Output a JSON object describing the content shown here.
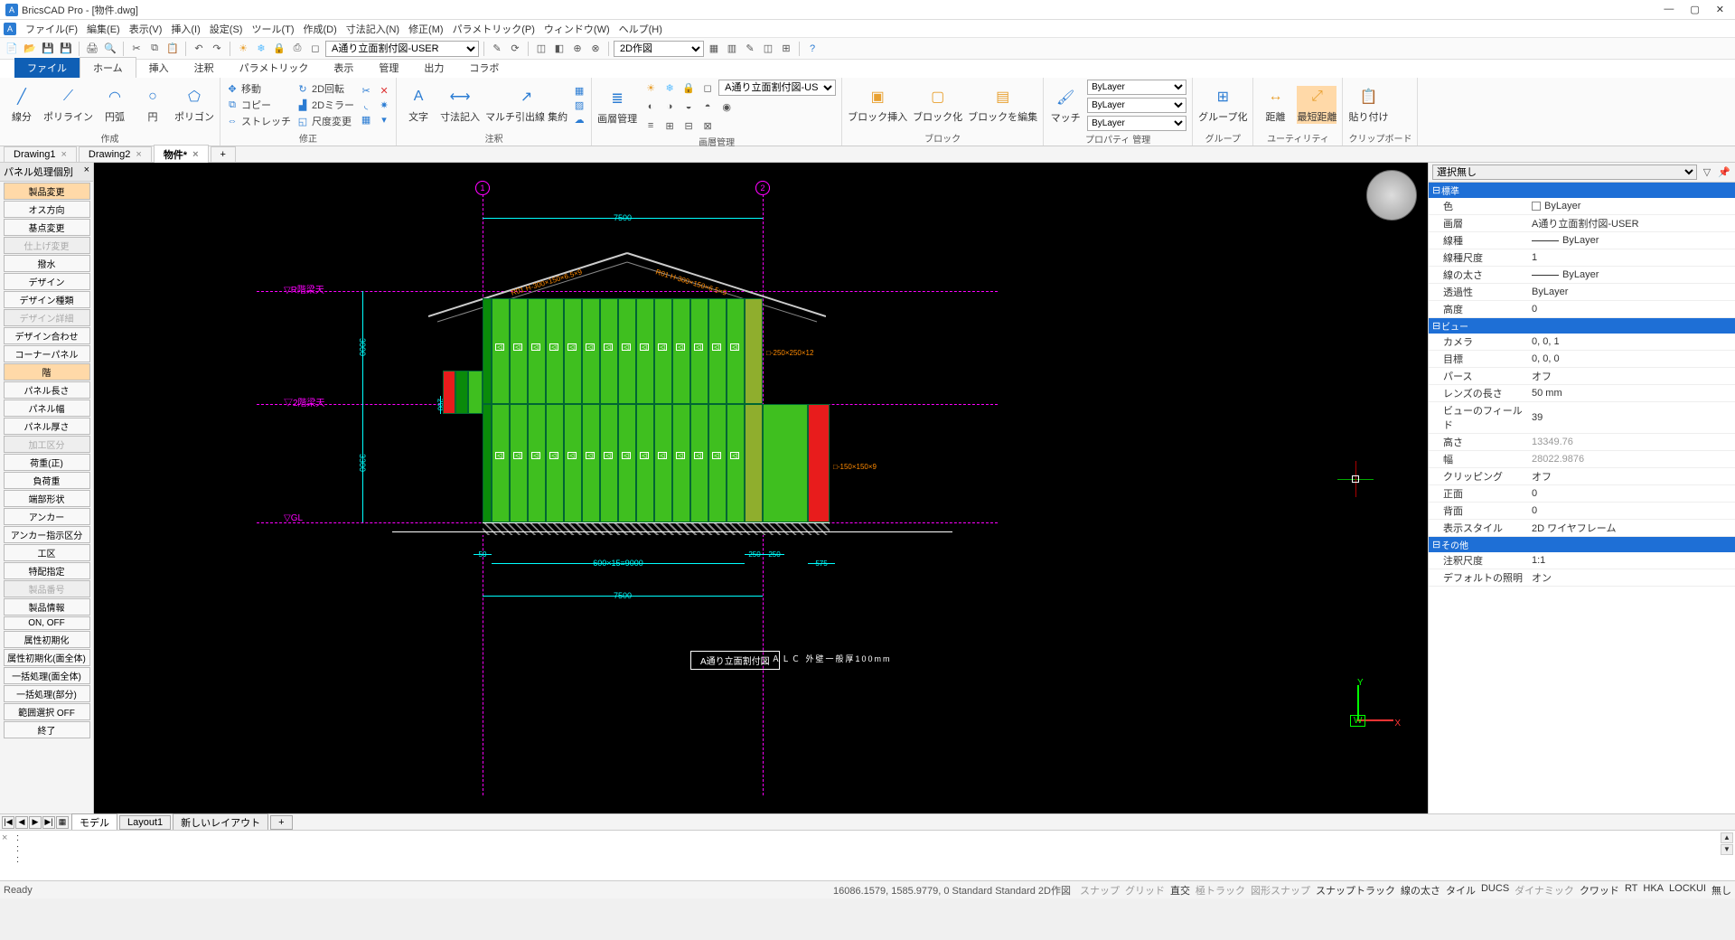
{
  "app": {
    "title": "BricsCAD Pro - [物件.dwg]"
  },
  "window_controls": {
    "min": "—",
    "max": "▢",
    "close": "✕"
  },
  "menubar": [
    "ファイル(F)",
    "編集(E)",
    "表示(V)",
    "挿入(I)",
    "設定(S)",
    "ツール(T)",
    "作成(D)",
    "寸法記入(N)",
    "修正(M)",
    "パラメトリック(P)",
    "ウィンドウ(W)",
    "ヘルプ(H)"
  ],
  "layer_combo1": "A通り立面割付図-USER",
  "view_combo": "2D作図",
  "ribbon_tabs": {
    "file": "ファイル",
    "items": [
      "ホーム",
      "挿入",
      "注釈",
      "パラメトリック",
      "表示",
      "管理",
      "出力",
      "コラボ"
    ],
    "active": 0
  },
  "ribbon_groups": {
    "create": {
      "label": "作成",
      "tools": [
        "線分",
        "ポリライン",
        "円弧",
        "円",
        "ポリゴン"
      ]
    },
    "modify": {
      "label": "修正",
      "rows": [
        [
          "移動",
          "2D回転"
        ],
        [
          "コピー",
          "2Dミラー"
        ],
        [
          "ストレッチ",
          "尺度変更"
        ]
      ]
    },
    "annot": {
      "label": "注釈",
      "tools": [
        "文字",
        "寸法記入",
        "マルチ引出線 集約"
      ]
    },
    "layer_mgr": {
      "label": "画層管理",
      "btn": "画層管理",
      "combo": "A通り立面割付図-USER"
    },
    "block": {
      "label": "ブロック",
      "tools": [
        "ブロック挿入",
        "ブロック化",
        "ブロックを編集"
      ]
    },
    "util": {
      "label": "ユーティリティ",
      "tool": "マッチ"
    },
    "prop": {
      "label": "プロパティ 管理",
      "combos": [
        "ByLayer",
        "ByLayer",
        "ByLayer"
      ]
    },
    "group": {
      "label": "グループ",
      "tool": "グループ化"
    },
    "dist": {
      "label": "",
      "tools": [
        "距離",
        "最短距離"
      ]
    },
    "clip": {
      "label": "クリップボード",
      "tool": "貼り付け"
    }
  },
  "doc_tabs": [
    {
      "label": "Drawing1",
      "close": "×"
    },
    {
      "label": "Drawing2",
      "close": "×"
    },
    {
      "label": "物件*",
      "close": "×",
      "active": true
    },
    {
      "label": "+"
    }
  ],
  "side_panel": {
    "title": "パネル処理個別",
    "buttons": [
      {
        "t": "製品変更",
        "hl": true
      },
      {
        "t": "オス方向"
      },
      {
        "t": "基点変更"
      },
      {
        "t": "仕上げ変更",
        "dis": true
      },
      {
        "t": "撥水"
      },
      {
        "t": "デザイン"
      },
      {
        "t": "デザイン種類"
      },
      {
        "t": "デザイン詳細",
        "dis": true
      },
      {
        "t": "デザイン合わせ"
      },
      {
        "t": "コーナーパネル"
      },
      {
        "t": "階",
        "hl": true
      },
      {
        "t": "パネル長さ"
      },
      {
        "t": "パネル幅"
      },
      {
        "t": "パネル厚さ"
      },
      {
        "t": "加工区分",
        "dis": true
      },
      {
        "t": "荷重(正)"
      },
      {
        "t": "負荷重"
      },
      {
        "t": "端部形状"
      },
      {
        "t": "アンカー"
      },
      {
        "t": "アンカー指示区分"
      },
      {
        "t": "工区"
      },
      {
        "t": "特配指定"
      },
      {
        "t": "製品番号",
        "dis": true
      },
      {
        "t": "製品情報"
      },
      {
        "t": "ON, OFF"
      },
      {
        "t": "属性初期化"
      },
      {
        "t": "属性初期化(面全体)"
      },
      {
        "t": "一括処理(面全体)"
      },
      {
        "t": "一括処理(部分)"
      },
      {
        "t": "範囲選択 OFF"
      },
      {
        "t": "終了"
      }
    ]
  },
  "drawing": {
    "bubbles": [
      "1",
      "2"
    ],
    "dim_top": "7500",
    "dim_bottom": "7500",
    "dim_v1": "3000",
    "dim_v2": "3300",
    "level_R": "▽R階梁天",
    "level_2": "▽2階梁天",
    "level_GL": "▽GL",
    "ann1": "□-250×250×12",
    "ann2": "□-150×150×9",
    "roof_ann_l": "R01 H-300×150×6.5×9",
    "roof_ann_r": "R01 H-300×150×6.5×9",
    "dim_seg1": "50",
    "dim_seg2": "600×15=9000",
    "dim_seg3": "250",
    "dim_seg4": "250",
    "dim_seg5": "575",
    "dim_200": "200",
    "title_box": "A通り立面割付図",
    "note": "ＡＬＣ 外壁一般厚100mm",
    "axis": {
      "y": "Y",
      "x": "X",
      "w": "W"
    }
  },
  "properties": {
    "header_sel": "選択無し",
    "cats": [
      {
        "name": "標準",
        "rows": [
          {
            "k": "色",
            "v": "ByLayer",
            "sw": "#fff"
          },
          {
            "k": "画層",
            "v": "A通り立面割付図-USER"
          },
          {
            "k": "線種",
            "v": "ByLayer",
            "line": true
          },
          {
            "k": "線種尺度",
            "v": "1"
          },
          {
            "k": "線の太さ",
            "v": "ByLayer",
            "line": true
          },
          {
            "k": "透過性",
            "v": "ByLayer"
          },
          {
            "k": "高度",
            "v": "0"
          }
        ]
      },
      {
        "name": "ビュー",
        "rows": [
          {
            "k": "カメラ",
            "v": "0, 0, 1"
          },
          {
            "k": "目標",
            "v": "0, 0, 0"
          },
          {
            "k": "パース",
            "v": "オフ"
          },
          {
            "k": "レンズの長さ",
            "v": "50 mm"
          },
          {
            "k": "ビューのフィールド",
            "v": "39"
          },
          {
            "k": "高さ",
            "v": "13349.76",
            "ro": true
          },
          {
            "k": "幅",
            "v": "28022.9876",
            "ro": true
          },
          {
            "k": "クリッピング",
            "v": "オフ"
          },
          {
            "k": "正面",
            "v": "0"
          },
          {
            "k": "背面",
            "v": "0"
          },
          {
            "k": "表示スタイル",
            "v": "2D ワイヤフレーム"
          }
        ]
      },
      {
        "name": "その他",
        "rows": [
          {
            "k": "注釈尺度",
            "v": "1:1"
          },
          {
            "k": "デフォルトの照明",
            "v": "オン"
          }
        ]
      }
    ]
  },
  "layout_tabs": {
    "nav": [
      "|◀",
      "◀",
      "▶",
      "▶|"
    ],
    "tabs": [
      "モデル",
      "Layout1",
      "新しいレイアウト",
      "+"
    ],
    "active": 0
  },
  "cmdline": {
    "prompts": [
      ":",
      ":",
      ":"
    ]
  },
  "statusbar": {
    "ready": "Ready",
    "coords": "16086.1579, 1585.9779, 0  Standard  Standard  2D作図",
    "toggles": [
      {
        "t": "スナップ"
      },
      {
        "t": "グリッド"
      },
      {
        "t": "直交",
        "on": true
      },
      {
        "t": "極トラック"
      },
      {
        "t": "図形スナップ"
      },
      {
        "t": "スナップトラック",
        "on": true
      },
      {
        "t": "線の太さ",
        "on": true
      },
      {
        "t": "タイル",
        "on": true
      },
      {
        "t": "DUCS",
        "on": true
      },
      {
        "t": "ダイナミック"
      },
      {
        "t": "クワッド",
        "on": true
      },
      {
        "t": "RT",
        "on": true
      },
      {
        "t": "HKA",
        "on": true
      },
      {
        "t": "LOCKUI",
        "on": true
      },
      {
        "t": "無し",
        "on": true
      }
    ]
  }
}
